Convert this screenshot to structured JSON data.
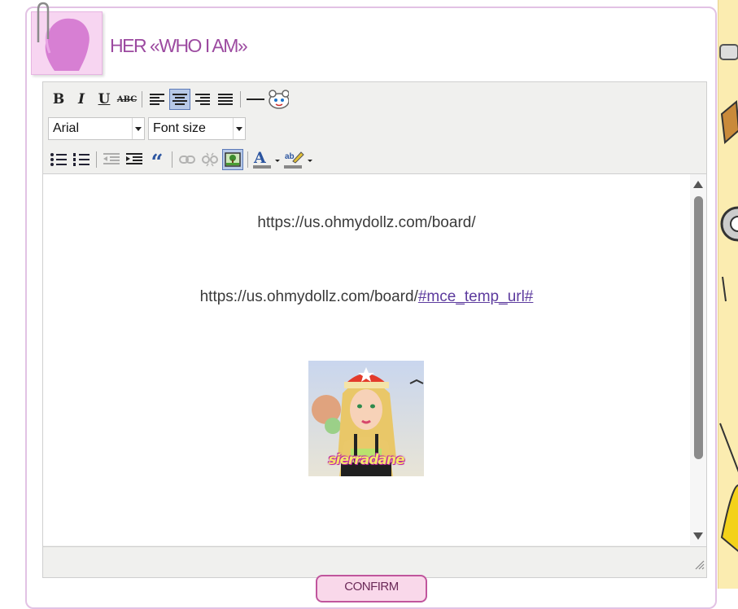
{
  "header": {
    "title": "HER «WHO I AM»"
  },
  "toolbar": {
    "row1": [
      {
        "name": "bold-button",
        "label": "B"
      },
      {
        "name": "italic-button",
        "label": "I"
      },
      {
        "name": "underline-button",
        "label": "U"
      },
      {
        "name": "strikethrough-button",
        "label": "ABC"
      }
    ],
    "font_family": "Arial",
    "font_size": "Font size",
    "quote_label": "“"
  },
  "content": {
    "line1": "https://us.ohmydollz.com/board/",
    "line2_prefix": "https://us.ohmydollz.com/board/",
    "line2_link": "#mce_temp_url#",
    "image_caption": "sierradane"
  },
  "footer": {
    "confirm_label": "CONFIRM"
  },
  "icons": {
    "align_center_active": "align-center-icon",
    "insert_image_active": "insert-image-icon"
  }
}
